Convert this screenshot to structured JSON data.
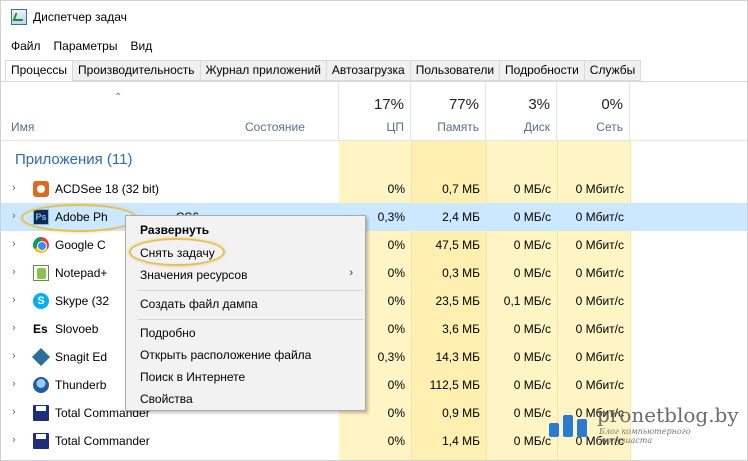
{
  "window": {
    "title": "Диспетчер задач"
  },
  "menu": [
    "Файл",
    "Параметры",
    "Вид"
  ],
  "tabs": [
    "Процессы",
    "Производительность",
    "Журнал приложений",
    "Автозагрузка",
    "Пользователи",
    "Подробности",
    "Службы"
  ],
  "header": {
    "name": "Имя",
    "state": "Состояние",
    "cpu": {
      "pct": "17%",
      "label": "ЦП"
    },
    "memory": {
      "pct": "77%",
      "label": "Память"
    },
    "disk": {
      "pct": "3%",
      "label": "Диск"
    },
    "network": {
      "pct": "0%",
      "label": "Сеть"
    }
  },
  "group_label": "Приложения (11)",
  "rows": [
    {
      "name": "ACDSee 18 (32 bit)",
      "icon": "acdsee-icon",
      "cpu": "0%",
      "mem": "0,7 МБ",
      "disk": "0 МБ/с",
      "net": "0 Мбит/с"
    },
    {
      "name": "Adobe Photoshop CS6",
      "icon": "photoshop-icon",
      "cpu": "0,3%",
      "mem": "2,4 МБ",
      "disk": "0 МБ/с",
      "net": "0 Мбит/с"
    },
    {
      "name": "Google Chrome",
      "icon": "chrome-icon",
      "cpu": "0%",
      "mem": "47,5 МБ",
      "disk": "0 МБ/с",
      "net": "0 Мбит/с"
    },
    {
      "name": "Notepad++",
      "icon": "notepad-plus-icon",
      "cpu": "0%",
      "mem": "0,3 МБ",
      "disk": "0 МБ/с",
      "net": "0 Мбит/с"
    },
    {
      "name": "Skype (32 bit)",
      "icon": "skype-icon",
      "cpu": "0%",
      "mem": "23,5 МБ",
      "disk": "0,1 МБ/с",
      "net": "0 Мбит/с"
    },
    {
      "name": "Slovoeb",
      "icon": "slovoeb-icon",
      "cpu": "0%",
      "mem": "3,6 МБ",
      "disk": "0 МБ/с",
      "net": "0 Мбит/с"
    },
    {
      "name": "Snagit Editor",
      "icon": "snagit-icon",
      "cpu": "0,3%",
      "mem": "14,3 МБ",
      "disk": "0 МБ/с",
      "net": "0 Мбит/с"
    },
    {
      "name": "Thunderbird",
      "icon": "thunderbird-icon",
      "cpu": "0%",
      "mem": "112,5 МБ",
      "disk": "0 МБ/с",
      "net": "0 Мбит/с"
    },
    {
      "name": "Total Commander",
      "icon": "total-commander-icon",
      "cpu": "0%",
      "mem": "0,9 МБ",
      "disk": "0 МБ/с",
      "net": "0 Мбит/с"
    },
    {
      "name": "Total Commander",
      "icon": "total-commander-icon",
      "cpu": "0%",
      "mem": "1,4 МБ",
      "disk": "0 МБ/с",
      "net": "0 Мбит/с"
    }
  ],
  "visible_names": [
    "ACDSee 18 (32 bit)",
    "Adobe Ph",
    "CS6",
    "Google C",
    "Notepad+",
    "Skype (32",
    "Slovoeb",
    "Snagit Ed",
    "Thunderb",
    "Total Commander",
    "Total Commander"
  ],
  "context_menu": {
    "expand": "Развернуть",
    "end_task": "Снять задачу",
    "resource_values": "Значения ресурсов",
    "create_dump": "Создать файл дампа",
    "details": "Подробно",
    "open_location": "Открыть расположение файла",
    "search_web": "Поиск в Интернете",
    "properties": "Свойства"
  },
  "watermark": {
    "title": "pronetblog.by",
    "subtitle": "Блог компьютерного энтузиаста"
  },
  "colors": {
    "group": "#2b6cb5",
    "selected_row": "#cce8ff",
    "shade": "#fff4c4",
    "highlight": "#e3c15a"
  }
}
